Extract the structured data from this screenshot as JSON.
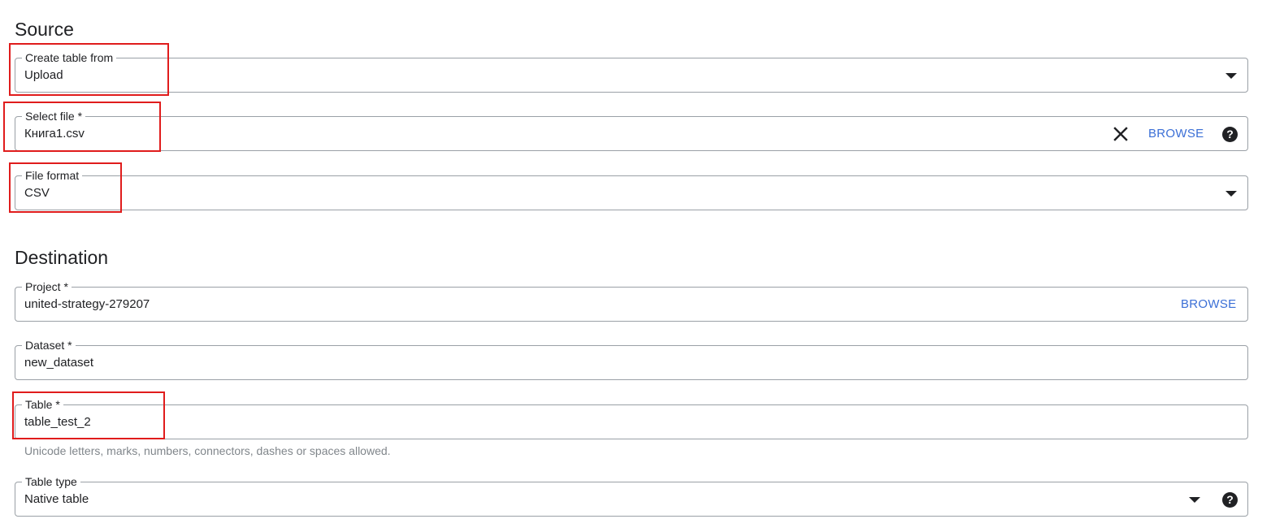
{
  "source": {
    "title": "Source",
    "create_table_from": {
      "label": "Create table from",
      "value": "Upload"
    },
    "select_file": {
      "label": "Select file *",
      "value": "Книга1.csv",
      "browse_label": "BROWSE",
      "help_glyph": "?"
    },
    "file_format": {
      "label": "File format",
      "value": "CSV"
    }
  },
  "destination": {
    "title": "Destination",
    "project": {
      "label": "Project *",
      "value": "united-strategy-279207",
      "browse_label": "BROWSE"
    },
    "dataset": {
      "label": "Dataset *",
      "value": "new_dataset"
    },
    "table": {
      "label": "Table *",
      "value": "table_test_2",
      "hint": "Unicode letters, marks, numbers, connectors, dashes or spaces allowed."
    },
    "table_type": {
      "label": "Table type",
      "value": "Native table",
      "help_glyph": "?"
    }
  },
  "icons": {
    "dropdown": "chevron-down-icon",
    "clear": "close-icon",
    "help": "help-icon"
  },
  "colors": {
    "link": "#3b6fd6",
    "highlight": "#e01c1c",
    "border": "#9aa0a6",
    "hint": "#80868b"
  }
}
